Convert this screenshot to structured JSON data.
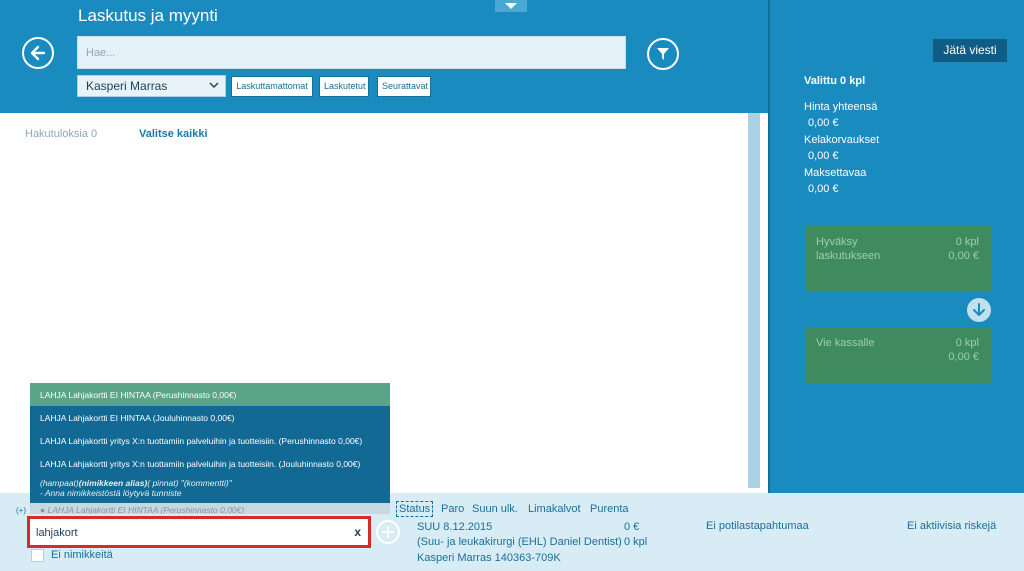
{
  "header": {
    "title": "Laskutus ja myynti",
    "search_placeholder": "Hae...",
    "patient_selected": "Kasperi Marras",
    "tabs": [
      "Laskuttamattomat",
      "Laskutetut",
      "Seurattavat"
    ]
  },
  "main": {
    "results_label": "Hakutuloksia 0",
    "select_all_label": "Valitse kaikki"
  },
  "right_panel": {
    "leave_message_label": "Jätä viesti",
    "selected_count": "Valittu 0 kpl",
    "total_label": "Hinta yhteensä",
    "total_value": "0,00 €",
    "kela_label": "Kelakorvaukset",
    "kela_value": "0,00 €",
    "pay_label": "Maksettavaa",
    "pay_value": "0,00 €",
    "approve": {
      "label_line1": "Hyväksy",
      "label_line2": "laskutukseen",
      "count": "0 kpl",
      "value": "0,00 €"
    },
    "cashier": {
      "label": "Vie kassalle",
      "count": "0 kpl",
      "value": "0,00 €"
    }
  },
  "suggestions": {
    "items": [
      "LAHJA Lahjakortti EI HINTAA (Perushinnasto 0,00€)",
      "LAHJA Lahjakortti EI HINTAA (Jouluhinnasto 0,00€)",
      "LAHJA Lahjakortti yritys X:n tuottamiin palveluihin ja tuotteisiin.  (Perushinnasto 0,00€)",
      "LAHJA Lahjakortti yritys X:n tuottamiin palveluihin ja tuotteisiin.  (Jouluhinnasto 0,00€)"
    ],
    "help_prefix": "(hampaat)",
    "help_bold": "(nimikkeen alias)",
    "help_suffix": "( pinnat)  \"(kommentti)\"",
    "help_line2": " - Anna nimikkeistöstä löytyvä tunniste",
    "ghost_item": "LAHJA Lahjakortti EI HINTAA (Perushinnasto 0,00€)"
  },
  "entry": {
    "plus_paren": "(+)",
    "value": "lahjakort",
    "clear_label": "x",
    "no_items_label": "Ei nimikkeitä"
  },
  "bottom_nav": {
    "status": "Status",
    "paro": "Paro",
    "suun": "Suun ulk.",
    "lima": "Limakalvot",
    "purenta": "Purenta"
  },
  "visit": {
    "date": "SUU 8.12.2015",
    "doctor": "(Suu- ja leukakirurgi (EHL) Daniel Dentist)",
    "patient": "Kasperi Marras 140363-709K",
    "eur": "0 €",
    "pcs": "0 kpl",
    "no_events": "Ei potilastapahtumaa",
    "no_risks": "Ei aktiivisia riskejä"
  }
}
